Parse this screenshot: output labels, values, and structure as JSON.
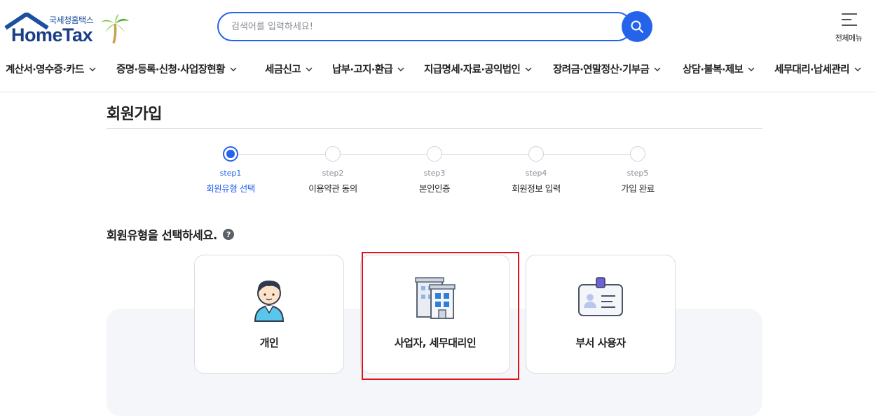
{
  "header": {
    "logo_sub": "국세청홈택스",
    "logo_main": "HomeTax",
    "search_placeholder": "검색어를 입력하세요!",
    "all_menu_label": "전체메뉴"
  },
  "nav": {
    "items": [
      {
        "label": "계산서·영수증·카드"
      },
      {
        "label": "증명·등록·신청·사업장현황"
      },
      {
        "label": "세금신고"
      },
      {
        "label": "납부·고지·환급"
      },
      {
        "label": "지급명세·자료·공익법인"
      },
      {
        "label": "장려금·연말정산·기부금"
      },
      {
        "label": "상담·불복·제보"
      },
      {
        "label": "세무대리·납세관리"
      }
    ]
  },
  "page": {
    "title": "회원가입"
  },
  "steps": [
    {
      "num": "step1",
      "label": "회원유형 선택",
      "active": true
    },
    {
      "num": "step2",
      "label": "이용약관 동의",
      "active": false
    },
    {
      "num": "step3",
      "label": "본인인증",
      "active": false
    },
    {
      "num": "step4",
      "label": "회원정보 입력",
      "active": false
    },
    {
      "num": "step5",
      "label": "가입 완료",
      "active": false
    }
  ],
  "member_type": {
    "prompt": "회원유형을 선택하세요.",
    "help_icon": "?",
    "cards": [
      {
        "label": "개인",
        "icon": "person-icon"
      },
      {
        "label": "사업자, 세무대리인",
        "icon": "building-icon",
        "highlighted": true
      },
      {
        "label": "부서 사용자",
        "icon": "id-card-icon"
      }
    ]
  },
  "colors": {
    "accent": "#2563eb",
    "highlight": "#e0131b",
    "panel": "#f4f6fa"
  }
}
